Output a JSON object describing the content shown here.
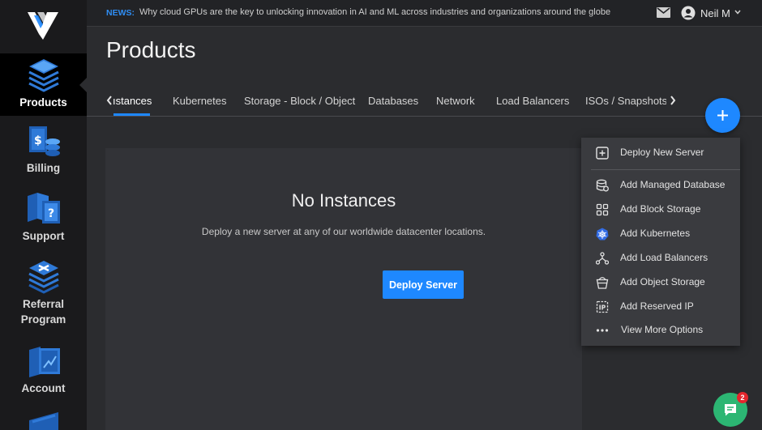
{
  "sidebar": {
    "items": [
      {
        "label": "Products",
        "icon": "products-icon",
        "active": true
      },
      {
        "label": "Billing",
        "icon": "billing-icon"
      },
      {
        "label": "Support",
        "icon": "support-icon"
      },
      {
        "label": "Referral Program",
        "label_line1": "Referral",
        "label_line2": "Program",
        "icon": "referral-icon"
      },
      {
        "label": "Account",
        "icon": "account-icon"
      }
    ]
  },
  "topbar": {
    "news_tag": "NEWS:",
    "news_text": "Why cloud GPUs are the key to unlocking innovation in AI and ML across industries and organizations around the globe",
    "user_name": "Neil M"
  },
  "page": {
    "title": "Products"
  },
  "tabs": [
    {
      "label": "ıstances",
      "active": true
    },
    {
      "label": "Kubernetes"
    },
    {
      "label": "Storage - Block / Object"
    },
    {
      "label": "Databases"
    },
    {
      "label": "Network"
    },
    {
      "label": "Load Balancers"
    },
    {
      "label": "ISOs / Snapshots / :"
    }
  ],
  "empty_state": {
    "title": "No Instances",
    "subtitle": "Deploy a new server at any of our worldwide datacenter locations.",
    "button": "Deploy Server"
  },
  "menu": {
    "items": [
      {
        "label": "Deploy New Server",
        "icon": "plus-square-icon"
      },
      {
        "label": "Add Managed Database",
        "icon": "database-icon"
      },
      {
        "label": "Add Block Storage",
        "icon": "grid-blocks-icon"
      },
      {
        "label": "Add Kubernetes",
        "icon": "kubernetes-icon"
      },
      {
        "label": "Add Load Balancers",
        "icon": "load-balancer-icon"
      },
      {
        "label": "Add Object Storage",
        "icon": "bucket-icon"
      },
      {
        "label": "Add Reserved IP",
        "icon": "ip-icon"
      },
      {
        "label": "View More Options",
        "icon": "more-dots-icon"
      }
    ]
  },
  "chat": {
    "badge_count": "2"
  },
  "colors": {
    "accent": "#1e88ff",
    "chat": "#2cb673",
    "badge": "#e4262d",
    "sidebar": "#1a1a1c",
    "background": "#2b2c2f"
  }
}
